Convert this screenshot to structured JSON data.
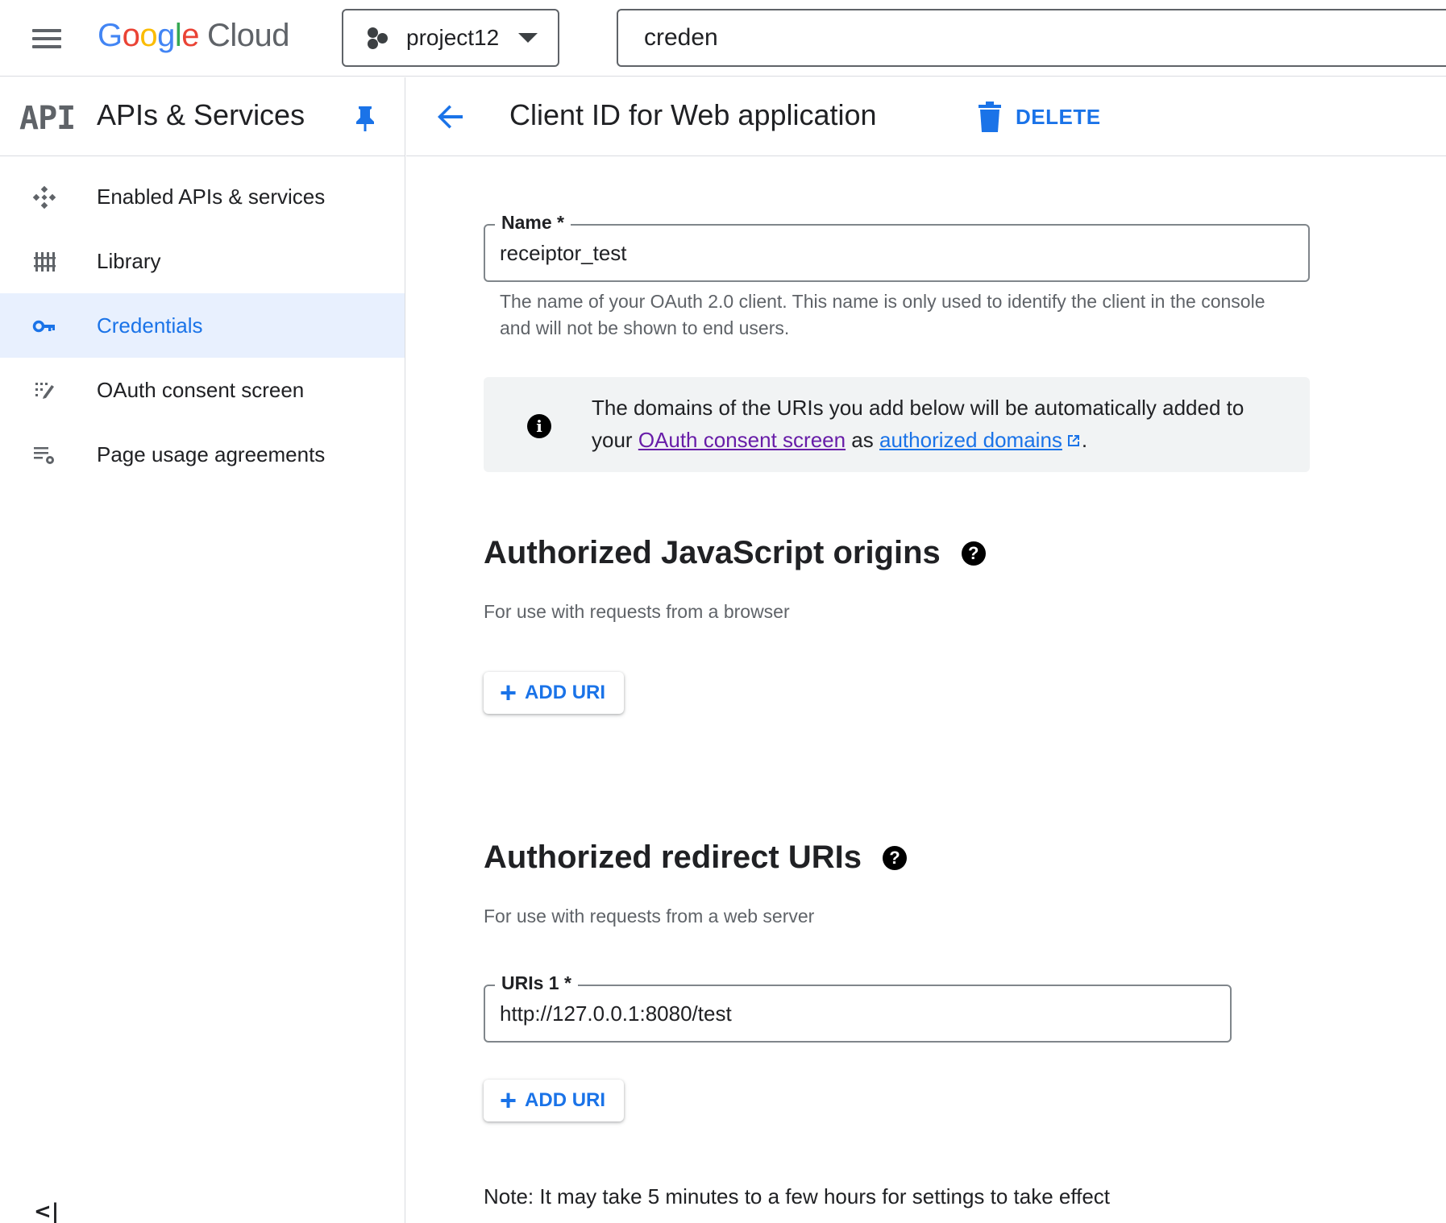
{
  "topbar": {
    "menu_icon": "hamburger-menu-icon",
    "logo": {
      "google": "Google",
      "product": "Cloud"
    },
    "project": {
      "name": "project12"
    },
    "search": {
      "value": "creden"
    }
  },
  "sidebar": {
    "logo": "API",
    "title": "APIs & Services",
    "items": [
      {
        "label": "Enabled APIs & services",
        "icon": "enabled-apis-icon",
        "active": false
      },
      {
        "label": "Library",
        "icon": "library-icon",
        "active": false
      },
      {
        "label": "Credentials",
        "icon": "key-icon",
        "active": true
      },
      {
        "label": "OAuth consent screen",
        "icon": "oauth-consent-icon",
        "active": false
      },
      {
        "label": "Page usage agreements",
        "icon": "page-usage-settings-icon",
        "active": false
      }
    ],
    "collapse_label": "<|"
  },
  "header": {
    "title": "Client ID for Web application",
    "delete_label": "DELETE"
  },
  "form": {
    "name": {
      "label": "Name *",
      "value": "receiptor_test",
      "hint": "The name of your OAuth 2.0 client. This name is only used to identify the client in the console and will not be shown to end users."
    },
    "info": {
      "text_before": "The domains of the URIs you add below will be automatically added to your ",
      "link1": "OAuth consent screen",
      "text_middle": " as ",
      "link2": "authorized domains",
      "text_after": "."
    },
    "js_origins": {
      "title": "Authorized JavaScript origins",
      "subtitle": "For use with requests from a browser",
      "add_label": "ADD URI"
    },
    "redirect_uris": {
      "title": "Authorized redirect URIs",
      "subtitle": "For use with requests from a web server",
      "uri_label": "URIs 1 *",
      "uri_value": "http://127.0.0.1:8080/test",
      "add_label": "ADD URI"
    },
    "note": "Note: It may take 5 minutes to a few hours for settings to take effect"
  },
  "colors": {
    "accent": "#1a73e8",
    "active_bg": "#e8f0fe",
    "visited_link": "#681da8",
    "info_bg": "#f1f3f4"
  }
}
